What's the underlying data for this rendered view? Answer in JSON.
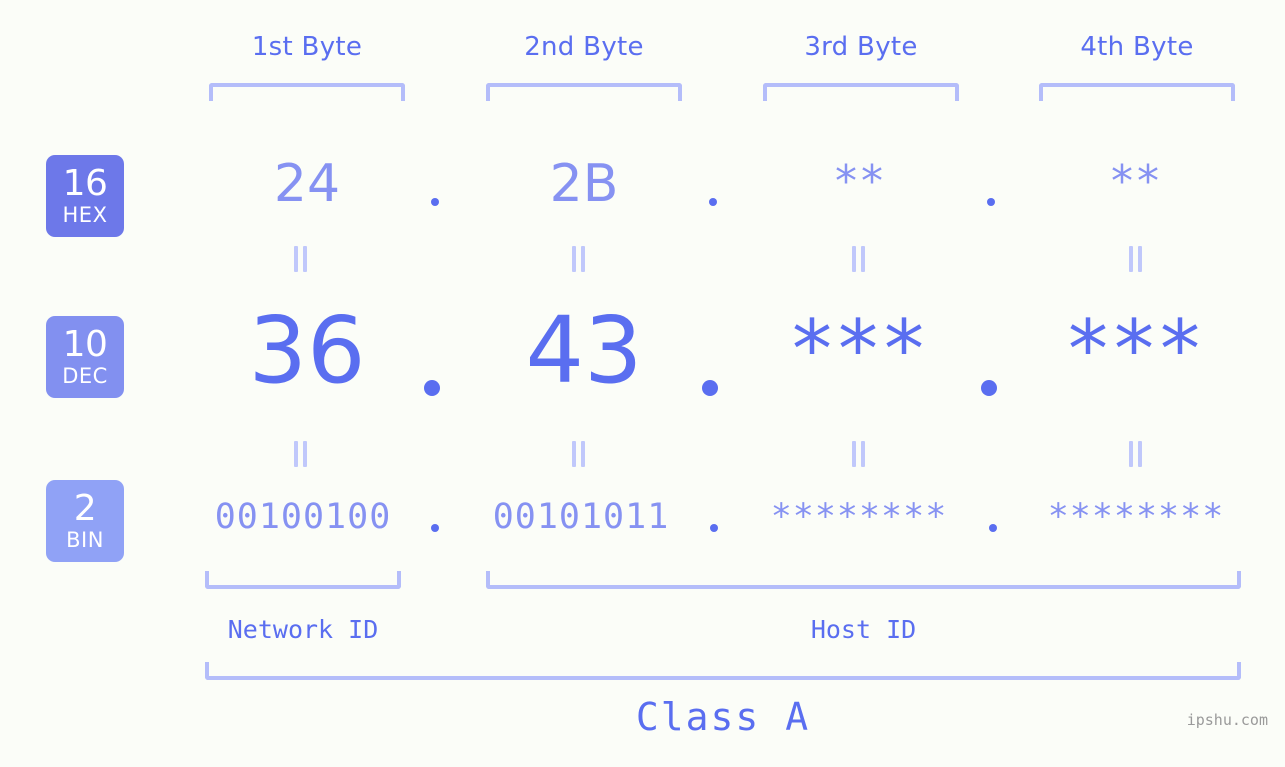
{
  "theme": {
    "background": "#fbfdf8",
    "accent_strong": "#5a6ef0",
    "accent_mid": "#8692f2",
    "accent_light": "#b4bdfa",
    "badge_hex_bg": "#6d78e9",
    "badge_dec_bg": "#8290f0",
    "badge_bin_bg": "#90a2f6",
    "watermark_color": "#9a9a9a"
  },
  "header": {
    "bytes": [
      {
        "label": "1st Byte"
      },
      {
        "label": "2nd Byte"
      },
      {
        "label": "3rd Byte"
      },
      {
        "label": "4th Byte"
      }
    ]
  },
  "bases": [
    {
      "number": "16",
      "name": "HEX"
    },
    {
      "number": "10",
      "name": "DEC"
    },
    {
      "number": "2",
      "name": "BIN"
    }
  ],
  "rows": {
    "hex": {
      "base_number": "16",
      "base_name": "HEX",
      "values": [
        "24",
        "2B",
        "**",
        "**"
      ]
    },
    "dec": {
      "base_number": "10",
      "base_name": "DEC",
      "values": [
        "36",
        "43",
        "***",
        "***"
      ]
    },
    "bin": {
      "base_number": "2",
      "base_name": "BIN",
      "values": [
        "00100100",
        "00101011",
        "********",
        "********"
      ]
    }
  },
  "separators": {
    "dot": ".",
    "equals": "="
  },
  "segments": {
    "network_id": "Network ID",
    "host_id": "Host ID",
    "class": "Class A"
  },
  "watermark": "ipshu.com"
}
